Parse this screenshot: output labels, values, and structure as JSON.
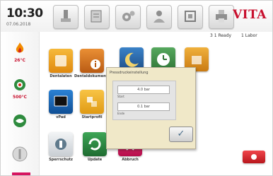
{
  "header": {
    "time": "10:30",
    "date": "07.06.2018",
    "brand": "VITA",
    "toolbar_icons": [
      "firing-program-icon",
      "program-list-icon",
      "settings-icon",
      "user-icon",
      "cooling-icon",
      "printer-icon"
    ]
  },
  "sidebar": {
    "temp_top": "26°C",
    "temp_mid": "500°C"
  },
  "status_bar": {
    "ready": "3 1 Ready",
    "labor": "1 Labor"
  },
  "tiles": [
    {
      "label": "Dentalaten",
      "color": "#f0a020",
      "icon": "dental-data-icon"
    },
    {
      "label": "Dentaldokumentation",
      "color": "#e07a1f",
      "icon": "info-icon"
    },
    {
      "label": "",
      "color": "#2c6aa8",
      "icon": "moon-icon"
    },
    {
      "label": "",
      "color": "#3f8d4a",
      "icon": "timer-icon"
    },
    {
      "label": "",
      "color": "#e08a1f",
      "icon": "tools-icon"
    },
    {
      "label": "vPad",
      "color": "#1a64b0",
      "icon": "vpad-icon"
    },
    {
      "label": "Startprofil",
      "color": "#f2b220",
      "icon": "start-profile-icon"
    },
    {
      "label": "Sperrschutz",
      "color": "#dfe3e6",
      "icon": "lock-icon"
    },
    {
      "label": "Update",
      "color": "#2d8d45",
      "icon": "update-icon"
    },
    {
      "label": "Abbruch",
      "color": "#d6145f",
      "icon": "abort-icon"
    }
  ],
  "dialog": {
    "title": "Pressdruckeinstellung",
    "field1_value": "4.0 bar",
    "field1_label": "Start",
    "field2_value": "0.1 bar",
    "field2_label": "Ende",
    "ok_symbol": "✓"
  }
}
